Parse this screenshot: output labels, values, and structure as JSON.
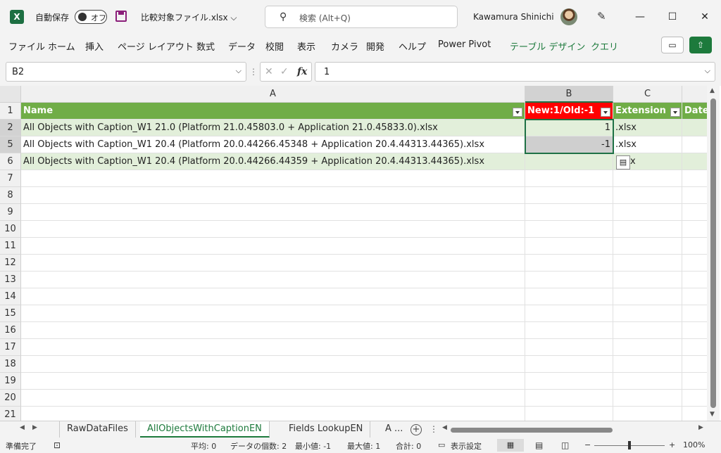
{
  "titlebar": {
    "app_logo": "X",
    "autosave_label": "自動保存",
    "autosave_state": "オフ",
    "filename": "比較対象ファイル.xlsx ⌵",
    "search_placeholder": "検索 (Alt+Q)",
    "username": "Kawamura Shinichi",
    "minimize": "—",
    "maximize": "☐",
    "close": "✕"
  },
  "ribbon": {
    "tabs": [
      "ファイル",
      "ホーム",
      "挿入",
      "ページ レイアウト",
      "数式",
      "データ",
      "校閲",
      "表示",
      "カメラ",
      "開発",
      "ヘルプ",
      "Power Pivot",
      "テーブル デザイン",
      "クエリ"
    ],
    "active_context_color": "#1d7a3c"
  },
  "formula_bar": {
    "name_box": "B2",
    "cancel": "✕",
    "enter": "✓",
    "fx": "fx",
    "value": "1"
  },
  "columns": [
    "A",
    "B",
    "C"
  ],
  "table": {
    "headers": [
      "Name",
      "New:1/Old:-1",
      "Extension",
      "Date"
    ],
    "rows": [
      {
        "row": "2",
        "name": "All Objects with Caption_W1 21.0 (Platform 21.0.45803.0 + Application 21.0.45833.0).xlsx",
        "flag": "1",
        "ext": ".xlsx"
      },
      {
        "row": "5",
        "name": "All Objects with Caption_W1 20.4 (Platform 20.0.44266.45348 + Application 20.4.44313.44365).xlsx",
        "flag": "-1",
        "ext": ".xlsx"
      },
      {
        "row": "6",
        "name": "All Objects with Caption_W1 20.4 (Platform 20.0.44266.44359 + Application 20.4.44313.44365).xlsx",
        "flag": "",
        "ext": "x"
      }
    ],
    "empty_rows": [
      "7",
      "8",
      "9",
      "10",
      "11",
      "12",
      "13",
      "14",
      "15",
      "16",
      "17",
      "18",
      "19",
      "20",
      "21"
    ],
    "header_row_label": "1"
  },
  "sheets": {
    "tabs": [
      "RawDataFiles",
      "AllObjectsWithCaptionEN",
      "Fields LookupEN",
      "A ..."
    ],
    "active": "AllObjectsWithCaptionEN",
    "add": "+"
  },
  "status": {
    "ready": "準備完了",
    "average": "平均: 0",
    "count": "データの個数: 2",
    "min": "最小値: -1",
    "max": "最大値: 1",
    "sum": "合計: 0",
    "display_settings": "表示設定",
    "zoom_minus": "−",
    "zoom_plus": "+",
    "zoom": "100%"
  },
  "colors": {
    "header_green": "#70ad47",
    "header_red": "#ff0000",
    "band": "#e2efda",
    "accent": "#1d7a3c"
  }
}
